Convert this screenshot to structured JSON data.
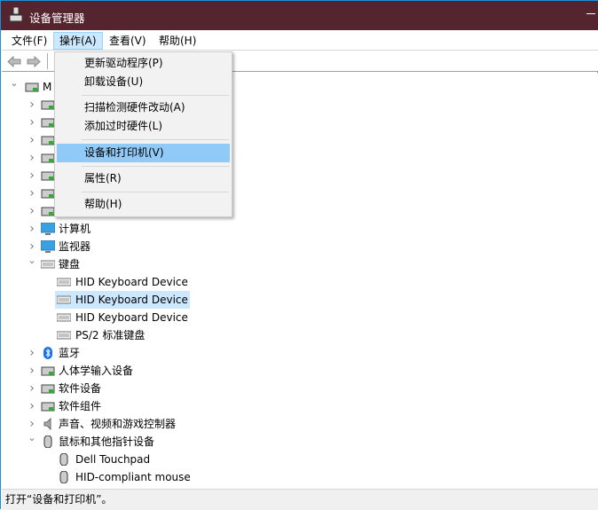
{
  "window": {
    "title": "设备管理器",
    "accent": "#55252f"
  },
  "menubar": [
    {
      "label": "文件(F)"
    },
    {
      "label": "操作(A)",
      "active": true
    },
    {
      "label": "查看(V)"
    },
    {
      "label": "帮助(H)"
    }
  ],
  "toolbar": {
    "back": "back-arrow",
    "forward": "forward-arrow"
  },
  "action_menu": [
    {
      "label": "更新驱动程序(P)"
    },
    {
      "label": "卸载设备(U)"
    },
    {
      "label": "扫描检测硬件改动(A)"
    },
    {
      "label": "添加过时硬件(L)"
    },
    {
      "label": "设备和打印机(V)",
      "highlighted": true
    },
    {
      "label": "属性(R)"
    },
    {
      "label": "帮助(H)"
    }
  ],
  "tree": [
    {
      "label": "M",
      "level": 0,
      "expanded": true,
      "icon": "computer-root-icon"
    },
    {
      "label": "",
      "level": 1,
      "icon": "disk-drive-icon"
    },
    {
      "label": "",
      "level": 1,
      "icon": "storage-controller-icon"
    },
    {
      "label": "",
      "level": 1,
      "icon": "processor-icon"
    },
    {
      "label": "",
      "level": 1,
      "icon": "drive-icon"
    },
    {
      "label": "",
      "level": 1,
      "icon": "network-adapter-icon"
    },
    {
      "label": "",
      "level": 1,
      "icon": "printer-icon"
    },
    {
      "label": "",
      "level": 1,
      "icon": "battery-icon"
    },
    {
      "label": "计算机",
      "level": 1,
      "icon": "monitor-icon"
    },
    {
      "label": "监视器",
      "level": 1,
      "icon": "monitor-icon"
    },
    {
      "label": "键盘",
      "level": 1,
      "expanded": true,
      "icon": "keyboard-icon"
    },
    {
      "label": "HID Keyboard Device",
      "level": 2,
      "icon": "keyboard-icon"
    },
    {
      "label": "HID Keyboard Device",
      "level": 2,
      "icon": "keyboard-icon",
      "selected": true
    },
    {
      "label": "HID Keyboard Device",
      "level": 2,
      "icon": "keyboard-icon"
    },
    {
      "label": "PS/2 标准键盘",
      "level": 2,
      "icon": "keyboard-icon"
    },
    {
      "label": "蓝牙",
      "level": 1,
      "icon": "bluetooth-icon"
    },
    {
      "label": "人体学输入设备",
      "level": 1,
      "icon": "hid-icon"
    },
    {
      "label": "软件设备",
      "level": 1,
      "icon": "software-device-icon"
    },
    {
      "label": "软件组件",
      "level": 1,
      "icon": "software-component-icon"
    },
    {
      "label": "声音、视频和游戏控制器",
      "level": 1,
      "icon": "speaker-icon"
    },
    {
      "label": "鼠标和其他指针设备",
      "level": 1,
      "expanded": true,
      "icon": "mouse-icon"
    },
    {
      "label": "Dell Touchpad",
      "level": 2,
      "icon": "mouse-icon"
    },
    {
      "label": "HID-compliant mouse",
      "level": 2,
      "icon": "mouse-icon"
    }
  ],
  "status": "打开“设备和打印机”。"
}
